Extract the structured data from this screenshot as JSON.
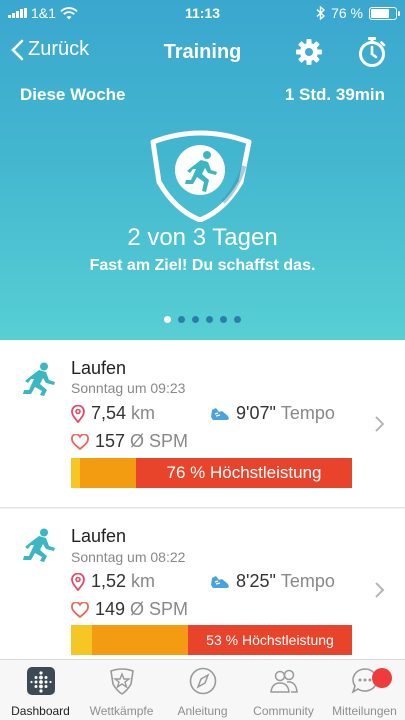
{
  "status_bar": {
    "carrier": "1&1",
    "time": "11:13",
    "battery": "76 %",
    "battery_level": 0.76
  },
  "nav": {
    "back_label": "Zurück",
    "title": "Training"
  },
  "week": {
    "label": "Diese Woche",
    "duration": "1 Std. 39min"
  },
  "goal": {
    "progress_text": "2 von 3 Tagen",
    "message": "Fast am Ziel! Du schaffst das.",
    "days_done": 2,
    "days_total": 3
  },
  "pager": {
    "count": 6,
    "active_index": 0
  },
  "activities": [
    {
      "title": "Laufen",
      "time": "Sonntag um 09:23",
      "distance": "7,54",
      "distance_unit": "km",
      "pace": "9'07\"",
      "pace_unit": "Tempo",
      "spm": "157",
      "spm_unit": "Ø SPM",
      "effort_label": "76 % Höchstleistung",
      "effort_percent": 76,
      "colors": {
        "low": "#f6c624",
        "mid": "#f39c12",
        "high": "#e8442b"
      }
    },
    {
      "title": "Laufen",
      "time": "Sonntag um 08:22",
      "distance": "1,52",
      "distance_unit": "km",
      "pace": "8'25\"",
      "pace_unit": "Tempo",
      "spm": "149",
      "spm_unit": "Ø SPM",
      "effort_label": "53 % Höchstleistung",
      "effort_percent": 53,
      "colors": {
        "low": "#f6c624",
        "mid": "#f39c12",
        "high": "#e8442b"
      }
    }
  ],
  "tabs": [
    {
      "label": "Dashboard",
      "icon": "dashboard-icon",
      "active": true
    },
    {
      "label": "Wettkämpfe",
      "icon": "challenges-icon",
      "active": false
    },
    {
      "label": "Anleitung",
      "icon": "compass-icon",
      "active": false
    },
    {
      "label": "Community",
      "icon": "community-icon",
      "active": false
    },
    {
      "label": "Mitteilungen",
      "icon": "messages-icon",
      "active": false,
      "badge": true
    }
  ],
  "theme": {
    "header_top": "#3aa7cf",
    "header_bottom": "#57cfd4",
    "accent": "#3ab7c2"
  }
}
